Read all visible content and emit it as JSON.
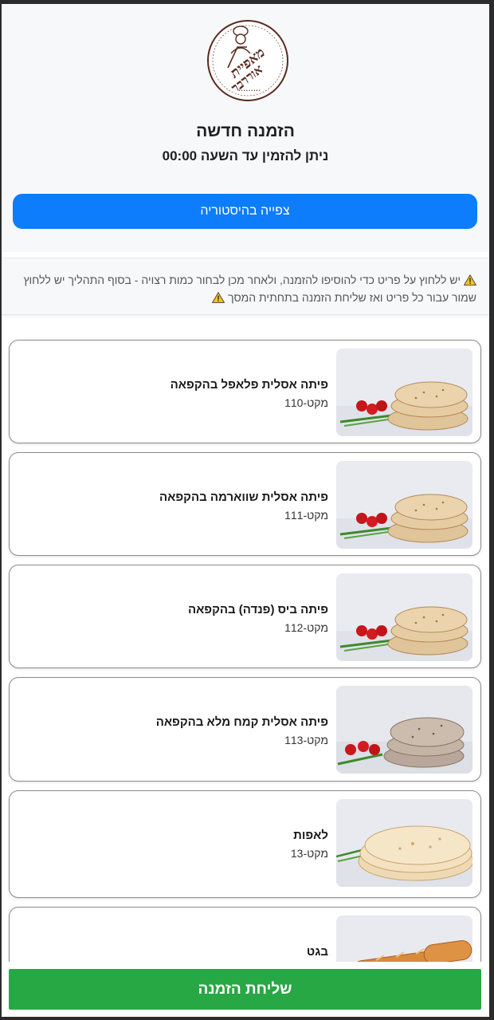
{
  "header": {
    "logo_text": "מאפיית אוררבר",
    "title": "הזמנה חדשה",
    "subtitle": "ניתן להזמין עד השעה 00:00",
    "history_button": "צפייה בהיסטוריה"
  },
  "notice": {
    "line1": "יש ללחוץ על פריט כדי להוסיפו להזמנה, ולאחר מכן לבחור כמות רצויה - בסוף התהליך יש ללחוץ",
    "line2": "שמור עבור כל פריט ואז שליחת הזמנה בתחתית המסך",
    "icon": "warning-icon"
  },
  "products": [
    {
      "name": "פיתה אסלית פלאפל בהקפאה",
      "sku": "מקט-110",
      "image": "pita-stack-image"
    },
    {
      "name": "פיתה אסלית שווארמה בהקפאה",
      "sku": "מקט-111",
      "image": "pita-stack-image"
    },
    {
      "name": "פיתה ביס (פנדה) בהקפאה",
      "sku": "מקט-112",
      "image": "pita-stack-image"
    },
    {
      "name": "פיתה אסלית קמח מלא בהקפאה",
      "sku": "מקט-113",
      "image": "wholewheat-pita-image"
    },
    {
      "name": "לאפות",
      "sku": "מקט-13",
      "image": "lafa-image"
    },
    {
      "name": "בגט",
      "sku": "",
      "image": "baguette-image"
    }
  ],
  "footer": {
    "submit_button": "שליחת הזמנה"
  },
  "colors": {
    "primary": "#0d7dfb",
    "success": "#28a745",
    "header_bg": "#f7f8fa"
  }
}
